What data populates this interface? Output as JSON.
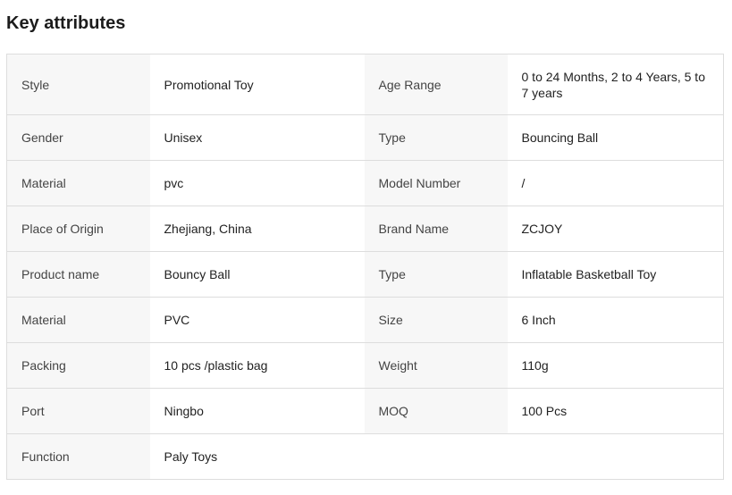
{
  "title": "Key attributes",
  "rows": [
    {
      "k1": "Style",
      "v1": "Promotional Toy",
      "k2": "Age Range",
      "v2": "0 to 24 Months, 2 to 4 Years, 5 to 7 years"
    },
    {
      "k1": "Gender",
      "v1": "Unisex",
      "k2": "Type",
      "v2": "Bouncing Ball"
    },
    {
      "k1": "Material",
      "v1": "pvc",
      "k2": "Model Number",
      "v2": "/"
    },
    {
      "k1": "Place of Origin",
      "v1": "Zhejiang, China",
      "k2": "Brand Name",
      "v2": "ZCJOY"
    },
    {
      "k1": "Product name",
      "v1": "Bouncy Ball",
      "k2": "Type",
      "v2": "Inflatable Basketball Toy"
    },
    {
      "k1": "Material",
      "v1": "PVC",
      "k2": "Size",
      "v2": "6 Inch"
    },
    {
      "k1": "Packing",
      "v1": "10 pcs /plastic bag",
      "k2": "Weight",
      "v2": "110g"
    },
    {
      "k1": "Port",
      "v1": "Ningbo",
      "k2": "MOQ",
      "v2": "100 Pcs"
    },
    {
      "k1": "Function",
      "v1": "Paly Toys",
      "k2": "",
      "v2": ""
    }
  ]
}
